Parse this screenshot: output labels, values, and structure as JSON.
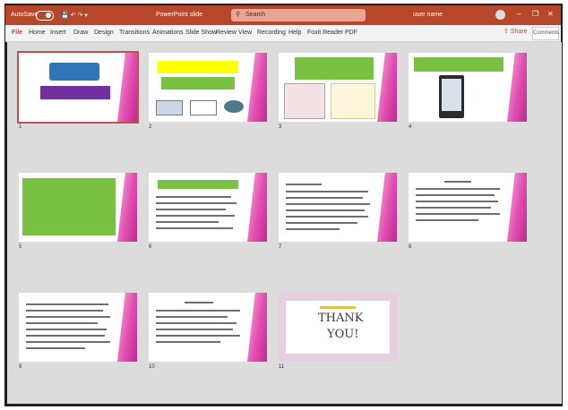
{
  "titlebar": {
    "autosave": "AutoSave",
    "doc_title": "PowerPoint slide",
    "search_placeholder": "Search",
    "user_name": "user name",
    "window_controls": [
      "–",
      "❐",
      "✕"
    ]
  },
  "ribbon": {
    "tabs": [
      "File",
      "Home",
      "Insert",
      "Draw",
      "Design",
      "Transitions",
      "Animations",
      "Slide Show",
      "Review",
      "View",
      "Recording",
      "Help",
      "Foxit Reader PDF"
    ],
    "share": "Share",
    "comments": "Comments"
  },
  "slides": [
    {
      "number": "1"
    },
    {
      "number": "2"
    },
    {
      "number": "3"
    },
    {
      "number": "4"
    },
    {
      "number": "5"
    },
    {
      "number": "6"
    },
    {
      "number": "7"
    },
    {
      "number": "8"
    },
    {
      "number": "9"
    },
    {
      "number": "10"
    },
    {
      "number": "11"
    }
  ],
  "thank_you": {
    "line1": "THANK",
    "line2": "YOU!"
  },
  "colors": {
    "accent": "#b7472a",
    "pink": "#e24fb1",
    "green": "#7ac143",
    "blue": "#2e75b6",
    "purple": "#7030a0",
    "yellow": "#ffff00"
  }
}
